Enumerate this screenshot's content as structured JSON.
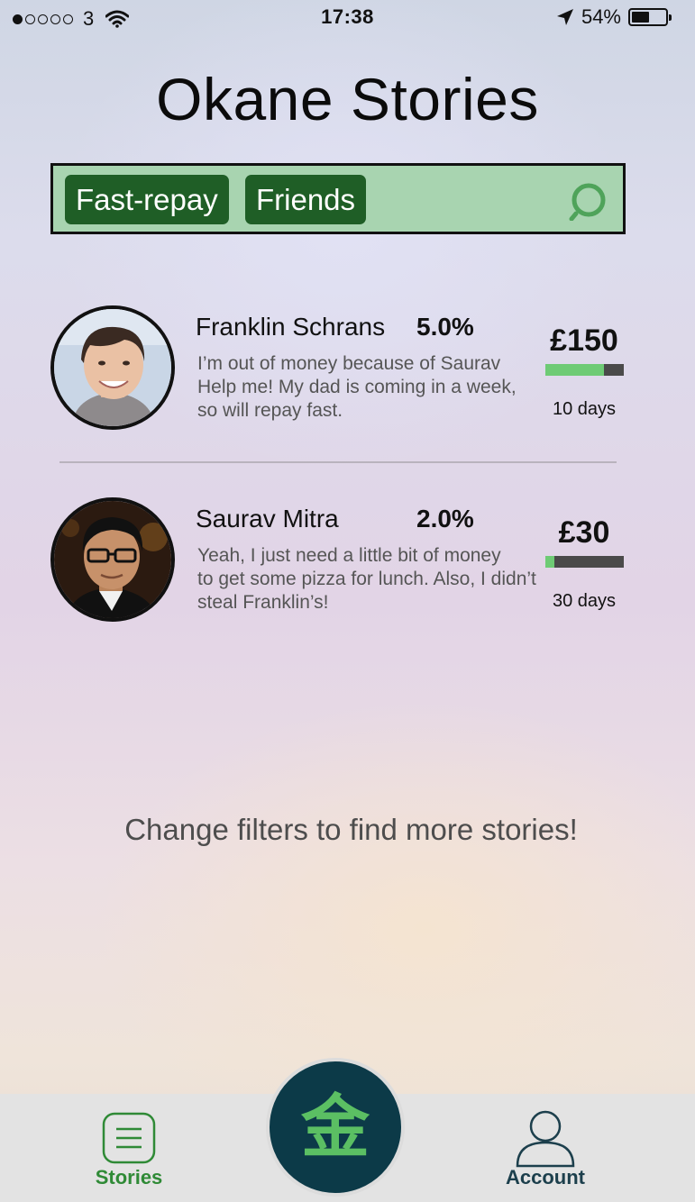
{
  "status_bar": {
    "carrier": "3",
    "time": "17:38",
    "battery_text": "54%",
    "battery_level": 0.54,
    "signal_bars_filled": 1,
    "signal_bars_total": 5
  },
  "title": "Okane Stories",
  "search": {
    "filters": [
      "Fast-repay",
      "Friends"
    ],
    "bar_color": "#a8d4b0",
    "chip_color": "#1f5e26"
  },
  "stories": [
    {
      "name": "Franklin Schrans",
      "rate": "5.0%",
      "text_lines": [
        "I’m out of money because of Saurav",
        "Help me! My dad is coming in a week,",
        "so will repay fast."
      ],
      "amount": "£150",
      "progress": 0.75,
      "days": "10 days"
    },
    {
      "name": "Saurav Mitra",
      "rate": "2.0%",
      "text_lines": [
        "Yeah, I just need a little bit of money",
        "to get some pizza for lunch. Also, I didn’t",
        "steal Franklin’s!"
      ],
      "amount": "£30",
      "progress": 0.12,
      "days": "30 days"
    }
  ],
  "hint": "Change filters to find more stories!",
  "tab_bar": {
    "stories_label": "Stories",
    "center_glyph": "金",
    "account_label": "Account",
    "active_color": "#2f8a36",
    "accent_color": "#0c3a48"
  }
}
